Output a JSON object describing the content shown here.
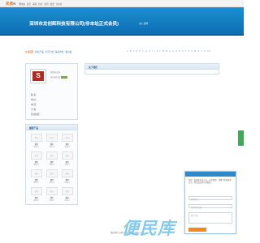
{
  "topbar": {
    "logo_main": "买卖",
    "logo_k": "K",
    "links": [
      "国内站",
      "首页",
      "采购",
      "供应",
      "资讯",
      "展会",
      "企业库"
    ]
  },
  "banner": {
    "company_title": "深圳市龙创辉科技有限公司(非本站正式会员)",
    "tagline": "进入官网"
  },
  "nav": {
    "lead": "公司首页",
    "items": [
      "供应产品",
      "公司介绍",
      "联系方式",
      "留言板"
    ],
    "alphabet": [
      "A",
      "B",
      "C",
      "D",
      "E",
      "F",
      "G",
      "H",
      "I",
      "J",
      "K",
      "L",
      "M",
      "N",
      "O",
      "P",
      "Q",
      "R",
      "S",
      "T",
      "U",
      "V",
      "W",
      "X",
      "Y",
      "Z",
      "0-9"
    ]
  },
  "profile": {
    "logo_letter": "S",
    "name_short": "深圳市龙创",
    "member_status": "未认证会员",
    "fields": [
      "联  系：",
      "地  址：",
      "电  话：",
      "手  机：",
      "营业执照："
    ]
  },
  "products": {
    "title": "图册产品",
    "placeholder": "暂无",
    "items": [
      {
        "name": "螺钉",
        "price": "面议/片"
      },
      {
        "name": "螺钉",
        "price": "面议/片"
      },
      {
        "name": "螺钉",
        "price": "面议/片"
      },
      {
        "name": "螺钉",
        "price": "面议/片"
      },
      {
        "name": "螺钉",
        "price": "面议/片"
      },
      {
        "name": "螺钉",
        "price": "面议/片"
      },
      {
        "name": "螺钉",
        "price": "面议/片"
      },
      {
        "name": "螺钉",
        "price": "面议/片"
      },
      {
        "name": "螺钉",
        "price": "面议/片"
      },
      {
        "name": "螺钉",
        "price": "面议/片"
      },
      {
        "name": "螺钉",
        "price": "面议/片"
      },
      {
        "name": "螺钉",
        "price": "面议/片"
      }
    ]
  },
  "main": {
    "title": "关于我们"
  },
  "chat": {
    "message": "您好，欢迎来访本公司，如有需要，请留下您的联系方式，我们会尽快与您联系。",
    "name_placeholder": "您的姓名",
    "phone_placeholder": "您的联系电话",
    "content_placeholder": "留言内容"
  },
  "footer": {
    "text": "版权所有 深圳市龙创辉科技有限公司"
  },
  "watermark": {
    "text": "便民库"
  },
  "colors": {
    "banner": "#1a8fd0",
    "accent": "#e2731c",
    "chat_button": "#f08a1c",
    "float_button": "#40a955"
  }
}
